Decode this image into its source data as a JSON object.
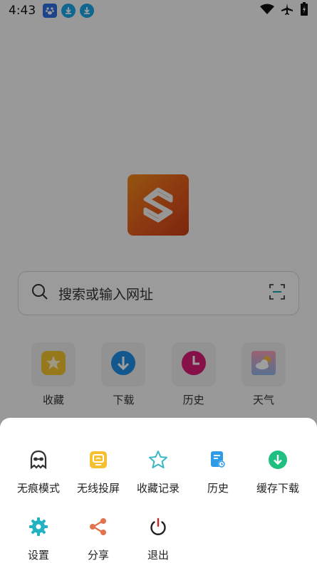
{
  "status_bar": {
    "time": "4:43"
  },
  "search": {
    "placeholder": "搜索或输入网址"
  },
  "quick_tiles": [
    {
      "label": "收藏",
      "icon": "star-folder-icon",
      "color": "#f2c230"
    },
    {
      "label": "下载",
      "icon": "download-icon",
      "color": "#1d8de6"
    },
    {
      "label": "历史",
      "icon": "clock-icon",
      "color": "#d81b74"
    },
    {
      "label": "天气",
      "icon": "weather-icon",
      "color": "#f4a3c0"
    }
  ],
  "menu": {
    "row1": [
      {
        "label": "无痕模式",
        "icon": "incognito-icon"
      },
      {
        "label": "无线投屏",
        "icon": "cast-icon"
      },
      {
        "label": "收藏记录",
        "icon": "star-icon"
      },
      {
        "label": "历史",
        "icon": "history-icon"
      },
      {
        "label": "缓存下载",
        "icon": "download-icon"
      }
    ],
    "row2": [
      {
        "label": "设置",
        "icon": "gear-icon"
      },
      {
        "label": "分享",
        "icon": "share-icon"
      },
      {
        "label": "退出",
        "icon": "power-icon"
      }
    ]
  }
}
